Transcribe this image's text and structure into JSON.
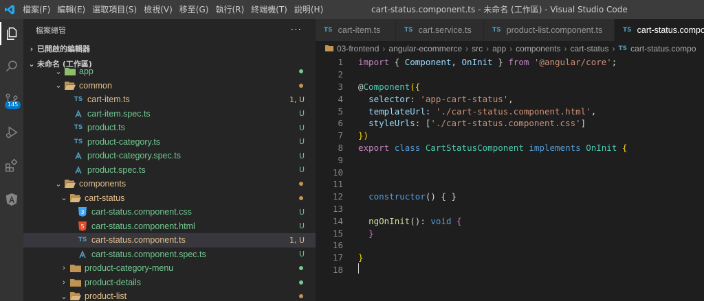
{
  "window": {
    "title": "cart-status.component.ts - 未命名 (工作區) - Visual Studio Code"
  },
  "menu": [
    "檔案(F)",
    "編輯(E)",
    "選取項目(S)",
    "檢視(V)",
    "移至(G)",
    "執行(R)",
    "終端機(T)",
    "說明(H)"
  ],
  "activity_bar": {
    "scm_badge": "145"
  },
  "sidebar": {
    "title": "檔案總管",
    "more": "···",
    "open_editors": "已開啟的編輯器",
    "workspace": "未命名 (工作區)",
    "tree": [
      {
        "label": "app",
        "status": "",
        "color": "#73c991"
      },
      {
        "label": "common",
        "status": "",
        "color": "#e2c08d"
      },
      {
        "label": "cart-item.ts",
        "status": "1, U",
        "color": "#e2c08d"
      },
      {
        "label": "cart-item.spec.ts",
        "status": "U",
        "color": "#73c991"
      },
      {
        "label": "product.ts",
        "status": "U",
        "color": "#73c991"
      },
      {
        "label": "product-category.ts",
        "status": "U",
        "color": "#73c991"
      },
      {
        "label": "product-category.spec.ts",
        "status": "U",
        "color": "#73c991"
      },
      {
        "label": "product.spec.ts",
        "status": "U",
        "color": "#73c991"
      },
      {
        "label": "components",
        "status": "",
        "color": "#e2c08d"
      },
      {
        "label": "cart-status",
        "status": "",
        "color": "#e2c08d"
      },
      {
        "label": "cart-status.component.css",
        "status": "U",
        "color": "#73c991"
      },
      {
        "label": "cart-status.component.html",
        "status": "U",
        "color": "#73c991"
      },
      {
        "label": "cart-status.component.ts",
        "status": "1, U",
        "color": "#e2c08d"
      },
      {
        "label": "cart-status.component.spec.ts",
        "status": "U",
        "color": "#73c991"
      },
      {
        "label": "product-category-menu",
        "status": "",
        "color": "#73c991"
      },
      {
        "label": "product-details",
        "status": "",
        "color": "#73c991"
      },
      {
        "label": "product-list",
        "status": "",
        "color": "#e2c08d"
      }
    ]
  },
  "tabs": [
    {
      "label": "cart-item.ts",
      "icon": "TS"
    },
    {
      "label": "cart.service.ts",
      "icon": "TS"
    },
    {
      "label": "product-list.component.ts",
      "icon": "TS"
    },
    {
      "label": "cart-status.compo",
      "icon": "TS"
    }
  ],
  "breadcrumb": [
    "03-frontend",
    "angular-ecommerce",
    "src",
    "app",
    "components",
    "cart-status",
    "cart-status.compo"
  ],
  "breadcrumb_ts": "TS",
  "line_numbers": [
    "1",
    "2",
    "3",
    "4",
    "5",
    "6",
    "7",
    "8",
    "9",
    "10",
    "11",
    "12",
    "13",
    "14",
    "15",
    "16",
    "17",
    "18"
  ],
  "code": {
    "l1": {
      "a": "import",
      "b": " { ",
      "c": "Component",
      "d": ", ",
      "e": "OnInit",
      "f": " } ",
      "g": "from",
      "h": " ",
      "i": "'@angular/core'",
      "j": ";"
    },
    "l3": {
      "a": "@",
      "b": "Component",
      "c": "({"
    },
    "l4": {
      "a": "selector",
      "b": ": ",
      "c": "'app-cart-status'",
      "d": ","
    },
    "l5": {
      "a": "templateUrl",
      "b": ": ",
      "c": "'./cart-status.component.html'",
      "d": ","
    },
    "l6": {
      "a": "styleUrls",
      "b": ": [",
      "c": "'./cart-status.component.css'",
      "d": "]"
    },
    "l7": {
      "a": "})"
    },
    "l8": {
      "a": "export",
      "b": " ",
      "c": "class",
      "d": " ",
      "e": "CartStatusComponent",
      "f": " ",
      "g": "implements",
      "h": " ",
      "i": "OnInit",
      "j": " {"
    },
    "l12": {
      "a": "constructor",
      "b": "() { }"
    },
    "l14": {
      "a": "ngOnInit",
      "b": "(): ",
      "c": "void",
      "d": " {"
    },
    "l15": {
      "a": "}"
    },
    "l17": {
      "a": "}"
    }
  }
}
